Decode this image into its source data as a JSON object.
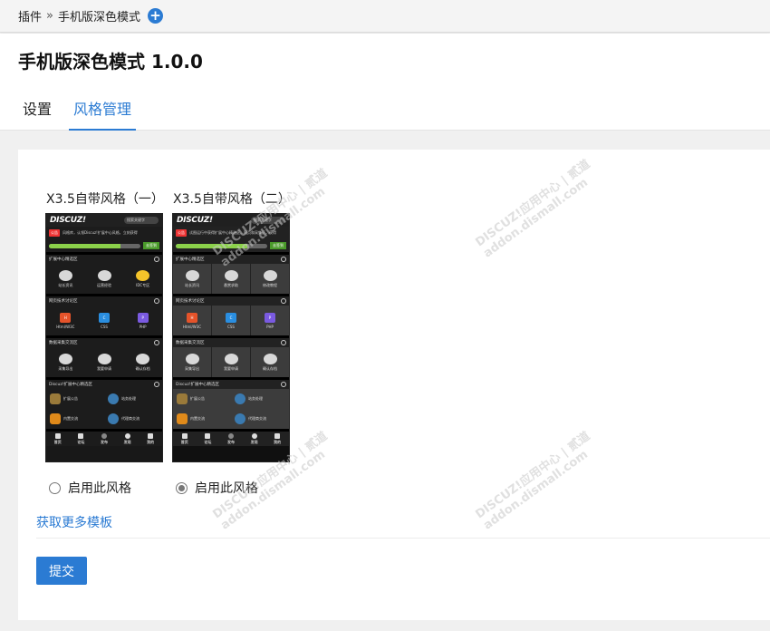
{
  "breadcrumb": {
    "root": "插件",
    "separator": "»",
    "current": "手机版深色模式"
  },
  "page": {
    "title": "手机版深色模式 1.0.0"
  },
  "tabs": [
    {
      "label": "设置"
    },
    {
      "label": "风格管理"
    }
  ],
  "themes": [
    {
      "name": "X3.5自带风格（一）",
      "radio_label": "启用此风格",
      "checked": false,
      "preview": {
        "logo": "DISCUZ!",
        "search": "搜索关键字",
        "notice_tag": "公告",
        "notice": "风格库，认领Discuz!扩展中心风格，立刻获得",
        "join": "去签到",
        "sections": [
          {
            "title": "扩展中心精选区",
            "items": [
              "站长资讯",
              "运营经验",
              "IDC专区"
            ]
          },
          {
            "title": "网页技术讨论区",
            "items": [
              "Html/W3C",
              "CSS",
              "PHP"
            ]
          },
          {
            "title": "数据采集交流区",
            "items": [
              "采集导出",
              "我要申请",
              "确认存档"
            ]
          },
          {
            "title": "Discuz!扩展中心精选区",
            "items": [
              "扩展公告",
              "站务处理",
              "内置交流",
              "代理商交流"
            ]
          }
        ],
        "nav": [
          "首页",
          "论坛",
          "发布",
          "发现",
          "我的"
        ]
      }
    },
    {
      "name": "X3.5自带风格（二）",
      "radio_label": "启用此风格",
      "checked": true,
      "preview": {
        "logo": "DISCUZ!",
        "search": "搜索关键字",
        "notice_tag": "公告",
        "notice": "试图运行中获得扩展中心精选区，网页和采集区，获得",
        "join": "去签到",
        "sections": [
          {
            "title": "扩展中心精选区",
            "items": [
              "站长资讯",
              "悬赏求助",
              "修改教程"
            ]
          },
          {
            "title": "网页技术讨论区",
            "items": [
              "Html/W3C",
              "CSS",
              "PHP"
            ]
          },
          {
            "title": "数据采集交流区",
            "items": [
              "采集导出",
              "我要申请",
              "确认存档"
            ]
          },
          {
            "title": "Discuz!扩展中心精选区",
            "items": [
              "扩展公告",
              "站务处理",
              "内置交流",
              "代理商交流"
            ]
          }
        ],
        "nav": [
          "首页",
          "论坛",
          "发布",
          "发现",
          "我的"
        ]
      }
    }
  ],
  "links": {
    "more_templates": "获取更多模板"
  },
  "actions": {
    "submit": "提交"
  },
  "watermark": {
    "line1": "DISCUZ!应用中心 | 贰道",
    "line2": "addon.dismall.com"
  },
  "colors": {
    "accent": "#2b7bd3"
  }
}
